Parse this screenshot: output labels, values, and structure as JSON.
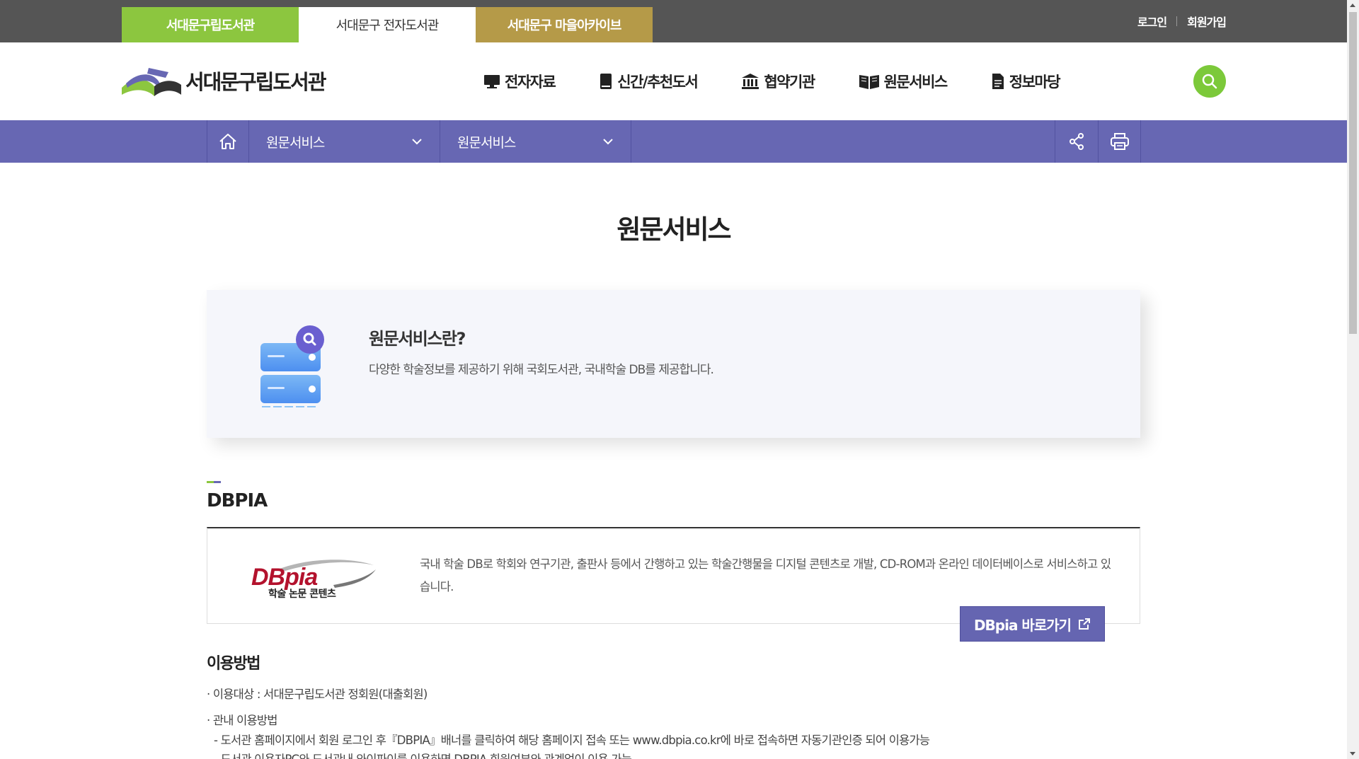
{
  "site_tabs": [
    "서대문구립도서관",
    "서대문구 전자도서관",
    "서대문구 마을아카이브"
  ],
  "util": {
    "login": "로그인",
    "join": "회원가입"
  },
  "logo": {
    "text": "서대문구립도서관"
  },
  "gnb": [
    {
      "label": "전자자료",
      "icon": "monitor-icon"
    },
    {
      "label": "신간/추천도서",
      "icon": "book-icon"
    },
    {
      "label": "협약기관",
      "icon": "institution-icon"
    },
    {
      "label": "원문서비스",
      "icon": "open-book-icon"
    },
    {
      "label": "정보마당",
      "icon": "document-icon"
    }
  ],
  "location": {
    "depth1": "원문서비스",
    "depth2": "원문서비스"
  },
  "page_title": "원문서비스",
  "intro": {
    "title": "원문서비스란?",
    "desc": "다양한 학술정보를 제공하기 위해 국회도서관, 국내학술 DB를 제공합니다."
  },
  "section": {
    "title": "DBPIA",
    "logo_caption": "학술 논문 콘텐츠",
    "desc": "국내 학술 DB로 학회와 연구기관, 출판사 등에서 간행하고 있는 학술간행물을 디지털 콘텐츠로 개발, CD-ROM과 온라인 데이터베이스로 서비스하고 있습니다.",
    "button": "DBpia 바로가기"
  },
  "usage": {
    "title": "이용방법",
    "lines": [
      "· 이용대상 : 서대문구립도서관 정회원(대출회원)",
      "· 관내 이용방법",
      "- 도서관 홈페이지에서 회원 로그인 후『DBPIA』배너를 클릭하여 해당 홈페이지 접속 또는 www.dbpia.co.kr에 바로 접속하면 자동기관인증 되어 이용가능",
      "- 도서관 이용자PC와 도서관내 와이파이를 이용하면 DBPIA 회원여부와 관계없이 이용 가능"
    ]
  },
  "colors": {
    "green": "#8cc63f",
    "gold": "#b59a48",
    "purple": "#6767b3"
  }
}
